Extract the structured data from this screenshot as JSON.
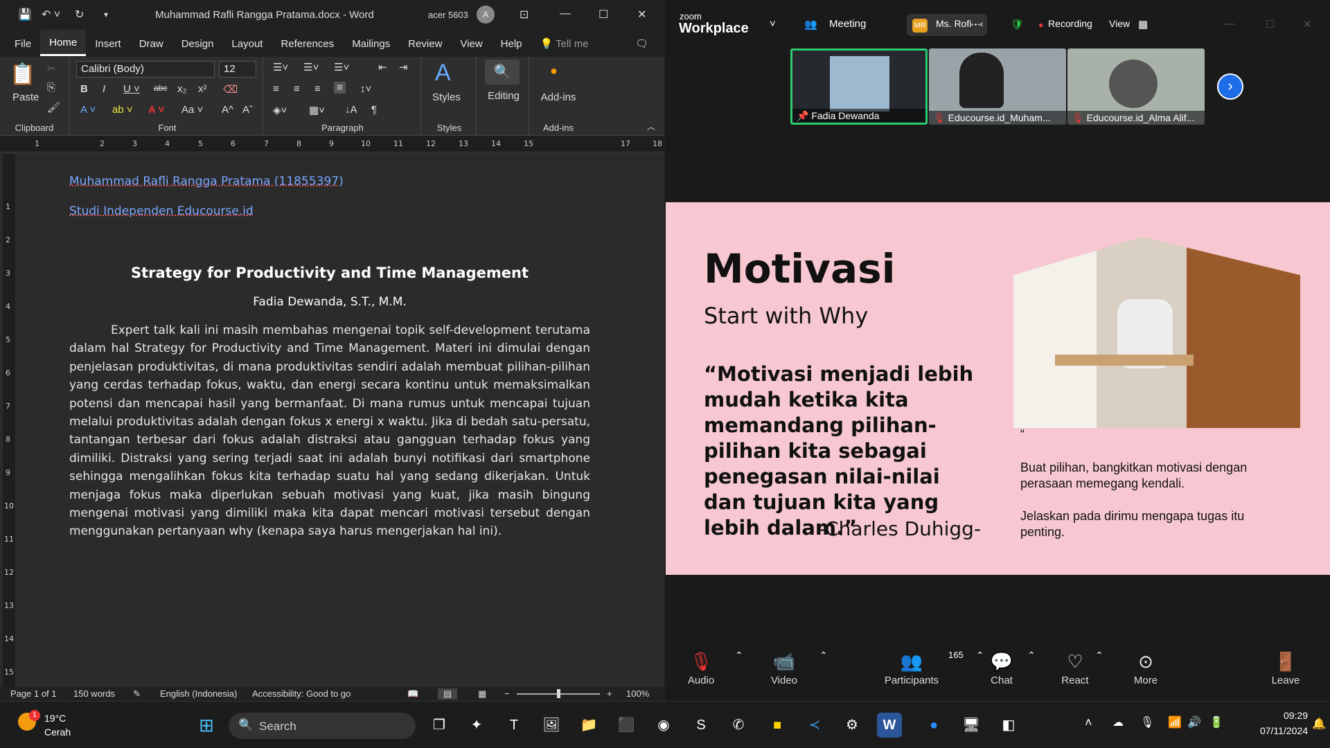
{
  "word": {
    "title": {
      "doc": "Muhammad Rafli Rangga Pratama.docx  -  Word",
      "user": "acer 5603",
      "avatar": "A"
    },
    "tabs": [
      "File",
      "Home",
      "Insert",
      "Draw",
      "Design",
      "Layout",
      "References",
      "Mailings",
      "Review",
      "View",
      "Help",
      "Tell me"
    ],
    "ribbon": {
      "paste": "Paste",
      "font_name": "Calibri (Body)",
      "font_size": "12",
      "styles": "Styles",
      "editing": "Editing",
      "addins": "Add-ins",
      "groups": {
        "clipboard": "Clipboard",
        "font": "Font",
        "paragraph": "Paragraph",
        "styles": "Styles",
        "addins": "Add-ins"
      }
    },
    "ruler": [
      "1",
      "2",
      "3",
      "4",
      "5",
      "6",
      "7",
      "8",
      "9",
      "10",
      "11",
      "12",
      "13",
      "14",
      "15",
      "17",
      "18"
    ],
    "vruler": [
      "1",
      "2",
      "3",
      "4",
      "5",
      "6",
      "7",
      "8",
      "9",
      "10",
      "11",
      "12",
      "13",
      "14",
      "15"
    ],
    "doc": {
      "line1": "Muhammad Rafli Rangga Pratama (11855397)",
      "line2": "Studi Independen Educourse.id",
      "title": "Strategy for Productivity and Time Management",
      "author": "Fadia Dewanda, S.T., M.M.",
      "body": "Expert talk kali ini masih membahas mengenai topik self-development terutama dalam hal Strategy for Productivity and Time Management. Materi ini dimulai dengan penjelasan produktivitas, di mana produktivitas sendiri adalah membuat pilihan-pilihan yang cerdas terhadap fokus, waktu, dan energi secara kontinu untuk memaksimalkan potensi dan mencapai hasil yang bermanfaat. Di mana rumus untuk mencapai tujuan melalui produktivitas adalah dengan fokus x energi x waktu. Jika di bedah satu-persatu, tantangan terbesar dari fokus adalah distraksi atau gangguan terhadap fokus yang dimiliki. Distraksi yang sering terjadi saat ini adalah bunyi notifikasi dari smartphone sehingga mengalihkan fokus kita terhadap suatu hal yang sedang dikerjakan. Untuk menjaga fokus maka diperlukan sebuah motivasi yang kuat, jika masih bingung mengenai motivasi yang dimiliki maka kita dapat mencari motivasi tersebut dengan menggunakan pertanyaan why (kenapa saya harus mengerjakan hal ini)."
    },
    "status": {
      "page": "Page 1 of 1",
      "words": "150 words",
      "lang": "English (Indonesia)",
      "access": "Accessibility: Good to go",
      "zoom": "100%"
    }
  },
  "zoom": {
    "brand_small": "zoom",
    "brand": "Workplace",
    "meeting": "Meeting",
    "host_initials": "MR",
    "host": "Ms. Rofi - ‹",
    "recording": "Recording",
    "view": "View",
    "tiles": [
      "Fadia Dewanda",
      "Educourse.id_Muham...",
      "Educourse.id_Alma Alif..."
    ],
    "slide": {
      "title": "Motivasi",
      "subtitle": "Start with Why",
      "quote": "“Motivasi menjadi lebih mudah ketika kita memandang pilihan-pilihan kita sebagai penegasan nilai-nilai dan tujuan kita yang lebih dalam.”",
      "author": "-Charles Duhigg-",
      "qmark": "“",
      "p1": "Buat pilihan, bangkitkan motivasi dengan perasaan memegang kendali.",
      "p2": "Jelaskan pada dirimu mengapa tugas itu penting."
    },
    "bar": {
      "audio": "Audio",
      "video": "Video",
      "participants": "Participants",
      "count": "165",
      "chat": "Chat",
      "react": "React",
      "more": "More",
      "leave": "Leave"
    }
  },
  "taskbar": {
    "temp": "19°C",
    "weather": "Cerah",
    "badge": "1",
    "search": "Search",
    "time": "09:29",
    "date": "07/11/2024"
  }
}
